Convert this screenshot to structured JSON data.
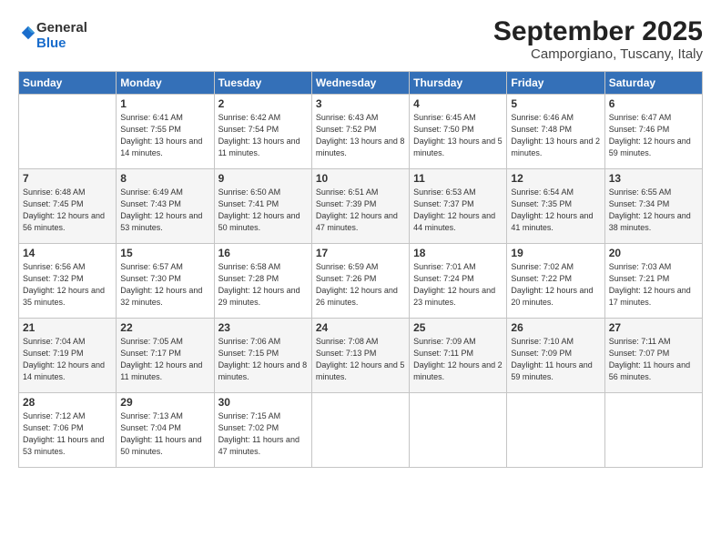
{
  "logo": {
    "general": "General",
    "blue": "Blue"
  },
  "title": "September 2025",
  "location": "Camporgiano, Tuscany, Italy",
  "weekdays": [
    "Sunday",
    "Monday",
    "Tuesday",
    "Wednesday",
    "Thursday",
    "Friday",
    "Saturday"
  ],
  "weeks": [
    [
      {
        "day": "",
        "sunrise": "",
        "sunset": "",
        "daylight": ""
      },
      {
        "day": "1",
        "sunrise": "Sunrise: 6:41 AM",
        "sunset": "Sunset: 7:55 PM",
        "daylight": "Daylight: 13 hours and 14 minutes."
      },
      {
        "day": "2",
        "sunrise": "Sunrise: 6:42 AM",
        "sunset": "Sunset: 7:54 PM",
        "daylight": "Daylight: 13 hours and 11 minutes."
      },
      {
        "day": "3",
        "sunrise": "Sunrise: 6:43 AM",
        "sunset": "Sunset: 7:52 PM",
        "daylight": "Daylight: 13 hours and 8 minutes."
      },
      {
        "day": "4",
        "sunrise": "Sunrise: 6:45 AM",
        "sunset": "Sunset: 7:50 PM",
        "daylight": "Daylight: 13 hours and 5 minutes."
      },
      {
        "day": "5",
        "sunrise": "Sunrise: 6:46 AM",
        "sunset": "Sunset: 7:48 PM",
        "daylight": "Daylight: 13 hours and 2 minutes."
      },
      {
        "day": "6",
        "sunrise": "Sunrise: 6:47 AM",
        "sunset": "Sunset: 7:46 PM",
        "daylight": "Daylight: 12 hours and 59 minutes."
      }
    ],
    [
      {
        "day": "7",
        "sunrise": "Sunrise: 6:48 AM",
        "sunset": "Sunset: 7:45 PM",
        "daylight": "Daylight: 12 hours and 56 minutes."
      },
      {
        "day": "8",
        "sunrise": "Sunrise: 6:49 AM",
        "sunset": "Sunset: 7:43 PM",
        "daylight": "Daylight: 12 hours and 53 minutes."
      },
      {
        "day": "9",
        "sunrise": "Sunrise: 6:50 AM",
        "sunset": "Sunset: 7:41 PM",
        "daylight": "Daylight: 12 hours and 50 minutes."
      },
      {
        "day": "10",
        "sunrise": "Sunrise: 6:51 AM",
        "sunset": "Sunset: 7:39 PM",
        "daylight": "Daylight: 12 hours and 47 minutes."
      },
      {
        "day": "11",
        "sunrise": "Sunrise: 6:53 AM",
        "sunset": "Sunset: 7:37 PM",
        "daylight": "Daylight: 12 hours and 44 minutes."
      },
      {
        "day": "12",
        "sunrise": "Sunrise: 6:54 AM",
        "sunset": "Sunset: 7:35 PM",
        "daylight": "Daylight: 12 hours and 41 minutes."
      },
      {
        "day": "13",
        "sunrise": "Sunrise: 6:55 AM",
        "sunset": "Sunset: 7:34 PM",
        "daylight": "Daylight: 12 hours and 38 minutes."
      }
    ],
    [
      {
        "day": "14",
        "sunrise": "Sunrise: 6:56 AM",
        "sunset": "Sunset: 7:32 PM",
        "daylight": "Daylight: 12 hours and 35 minutes."
      },
      {
        "day": "15",
        "sunrise": "Sunrise: 6:57 AM",
        "sunset": "Sunset: 7:30 PM",
        "daylight": "Daylight: 12 hours and 32 minutes."
      },
      {
        "day": "16",
        "sunrise": "Sunrise: 6:58 AM",
        "sunset": "Sunset: 7:28 PM",
        "daylight": "Daylight: 12 hours and 29 minutes."
      },
      {
        "day": "17",
        "sunrise": "Sunrise: 6:59 AM",
        "sunset": "Sunset: 7:26 PM",
        "daylight": "Daylight: 12 hours and 26 minutes."
      },
      {
        "day": "18",
        "sunrise": "Sunrise: 7:01 AM",
        "sunset": "Sunset: 7:24 PM",
        "daylight": "Daylight: 12 hours and 23 minutes."
      },
      {
        "day": "19",
        "sunrise": "Sunrise: 7:02 AM",
        "sunset": "Sunset: 7:22 PM",
        "daylight": "Daylight: 12 hours and 20 minutes."
      },
      {
        "day": "20",
        "sunrise": "Sunrise: 7:03 AM",
        "sunset": "Sunset: 7:21 PM",
        "daylight": "Daylight: 12 hours and 17 minutes."
      }
    ],
    [
      {
        "day": "21",
        "sunrise": "Sunrise: 7:04 AM",
        "sunset": "Sunset: 7:19 PM",
        "daylight": "Daylight: 12 hours and 14 minutes."
      },
      {
        "day": "22",
        "sunrise": "Sunrise: 7:05 AM",
        "sunset": "Sunset: 7:17 PM",
        "daylight": "Daylight: 12 hours and 11 minutes."
      },
      {
        "day": "23",
        "sunrise": "Sunrise: 7:06 AM",
        "sunset": "Sunset: 7:15 PM",
        "daylight": "Daylight: 12 hours and 8 minutes."
      },
      {
        "day": "24",
        "sunrise": "Sunrise: 7:08 AM",
        "sunset": "Sunset: 7:13 PM",
        "daylight": "Daylight: 12 hours and 5 minutes."
      },
      {
        "day": "25",
        "sunrise": "Sunrise: 7:09 AM",
        "sunset": "Sunset: 7:11 PM",
        "daylight": "Daylight: 12 hours and 2 minutes."
      },
      {
        "day": "26",
        "sunrise": "Sunrise: 7:10 AM",
        "sunset": "Sunset: 7:09 PM",
        "daylight": "Daylight: 11 hours and 59 minutes."
      },
      {
        "day": "27",
        "sunrise": "Sunrise: 7:11 AM",
        "sunset": "Sunset: 7:07 PM",
        "daylight": "Daylight: 11 hours and 56 minutes."
      }
    ],
    [
      {
        "day": "28",
        "sunrise": "Sunrise: 7:12 AM",
        "sunset": "Sunset: 7:06 PM",
        "daylight": "Daylight: 11 hours and 53 minutes."
      },
      {
        "day": "29",
        "sunrise": "Sunrise: 7:13 AM",
        "sunset": "Sunset: 7:04 PM",
        "daylight": "Daylight: 11 hours and 50 minutes."
      },
      {
        "day": "30",
        "sunrise": "Sunrise: 7:15 AM",
        "sunset": "Sunset: 7:02 PM",
        "daylight": "Daylight: 11 hours and 47 minutes."
      },
      {
        "day": "",
        "sunrise": "",
        "sunset": "",
        "daylight": ""
      },
      {
        "day": "",
        "sunrise": "",
        "sunset": "",
        "daylight": ""
      },
      {
        "day": "",
        "sunrise": "",
        "sunset": "",
        "daylight": ""
      },
      {
        "day": "",
        "sunrise": "",
        "sunset": "",
        "daylight": ""
      }
    ]
  ]
}
